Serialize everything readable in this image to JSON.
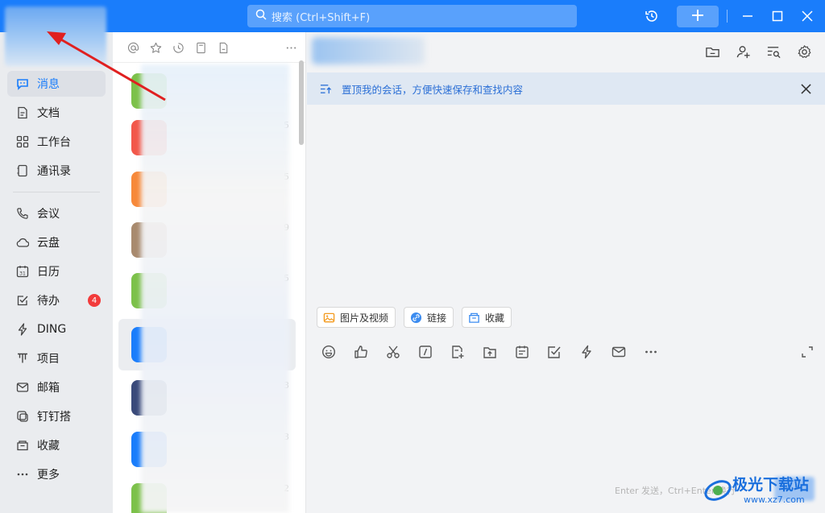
{
  "titlebar": {
    "search_placeholder": "搜索 (Ctrl+Shift+F)",
    "icons": [
      "history-icon",
      "plus-icon",
      "minimize-icon",
      "maximize-icon",
      "close-icon"
    ]
  },
  "sidebar": {
    "items": [
      {
        "label": "消息",
        "icon": "message-icon",
        "active": true
      },
      {
        "label": "文档",
        "icon": "document-icon"
      },
      {
        "label": "工作台",
        "icon": "grid-icon"
      },
      {
        "label": "通讯录",
        "icon": "contacts-icon"
      },
      {
        "label": "会议",
        "icon": "phone-icon"
      },
      {
        "label": "云盘",
        "icon": "cloud-icon"
      },
      {
        "label": "日历",
        "icon": "calendar-icon"
      },
      {
        "label": "待办",
        "icon": "todo-icon",
        "badge": "4"
      },
      {
        "label": "DING",
        "icon": "lightning-icon"
      },
      {
        "label": "项目",
        "icon": "project-icon"
      },
      {
        "label": "邮箱",
        "icon": "mail-icon"
      },
      {
        "label": "钉钉搭",
        "icon": "builder-icon"
      },
      {
        "label": "收藏",
        "icon": "favorite-icon"
      },
      {
        "label": "更多",
        "icon": "more-icon"
      }
    ]
  },
  "conversations": {
    "toolbar_icons": [
      "at-icon",
      "star-icon",
      "clock-icon",
      "bookmark-icon",
      "file-icon",
      "more-icon"
    ],
    "times": [
      "5",
      "5",
      "9",
      "5",
      "3",
      "3",
      "2"
    ]
  },
  "chat": {
    "pin_banner": "置顶我的会话，方便快速保存和查找内容",
    "chips": {
      "images": "图片及视频",
      "links": "链接",
      "favorites": "收藏"
    },
    "input_hint": "Enter 发送，Ctrl+Enter 换行"
  },
  "watermark": {
    "name": "极光下载站",
    "url": "www.xz7.com"
  },
  "colors": {
    "brand": "#1a7dfb",
    "badge": "#f23b3b",
    "arrow": "#e02020"
  }
}
